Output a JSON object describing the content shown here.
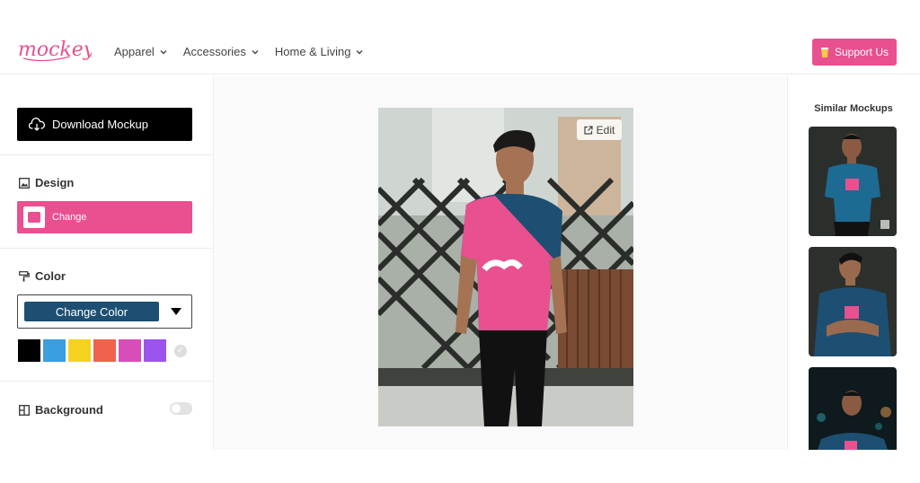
{
  "header": {
    "logo_text": "mockey",
    "nav": [
      {
        "label": "Apparel"
      },
      {
        "label": "Accessories"
      },
      {
        "label": "Home & Living"
      }
    ],
    "support_label": "Support Us"
  },
  "sidebar": {
    "download_label": "Download Mockup",
    "design_title": "Design",
    "design_change_label": "Change",
    "color_title": "Color",
    "color_select_value": "Change Color",
    "swatches": [
      "#000000",
      "#3a9ee0",
      "#f5d21f",
      "#f0624d",
      "#d94db8",
      "#9b55ee"
    ],
    "background_title": "Background",
    "background_toggle_on": false
  },
  "canvas": {
    "edit_label": "Edit"
  },
  "similar": {
    "title": "Similar Mockups"
  },
  "colors": {
    "accent": "#e8508f",
    "shirt_blue": "#1d4f72"
  }
}
